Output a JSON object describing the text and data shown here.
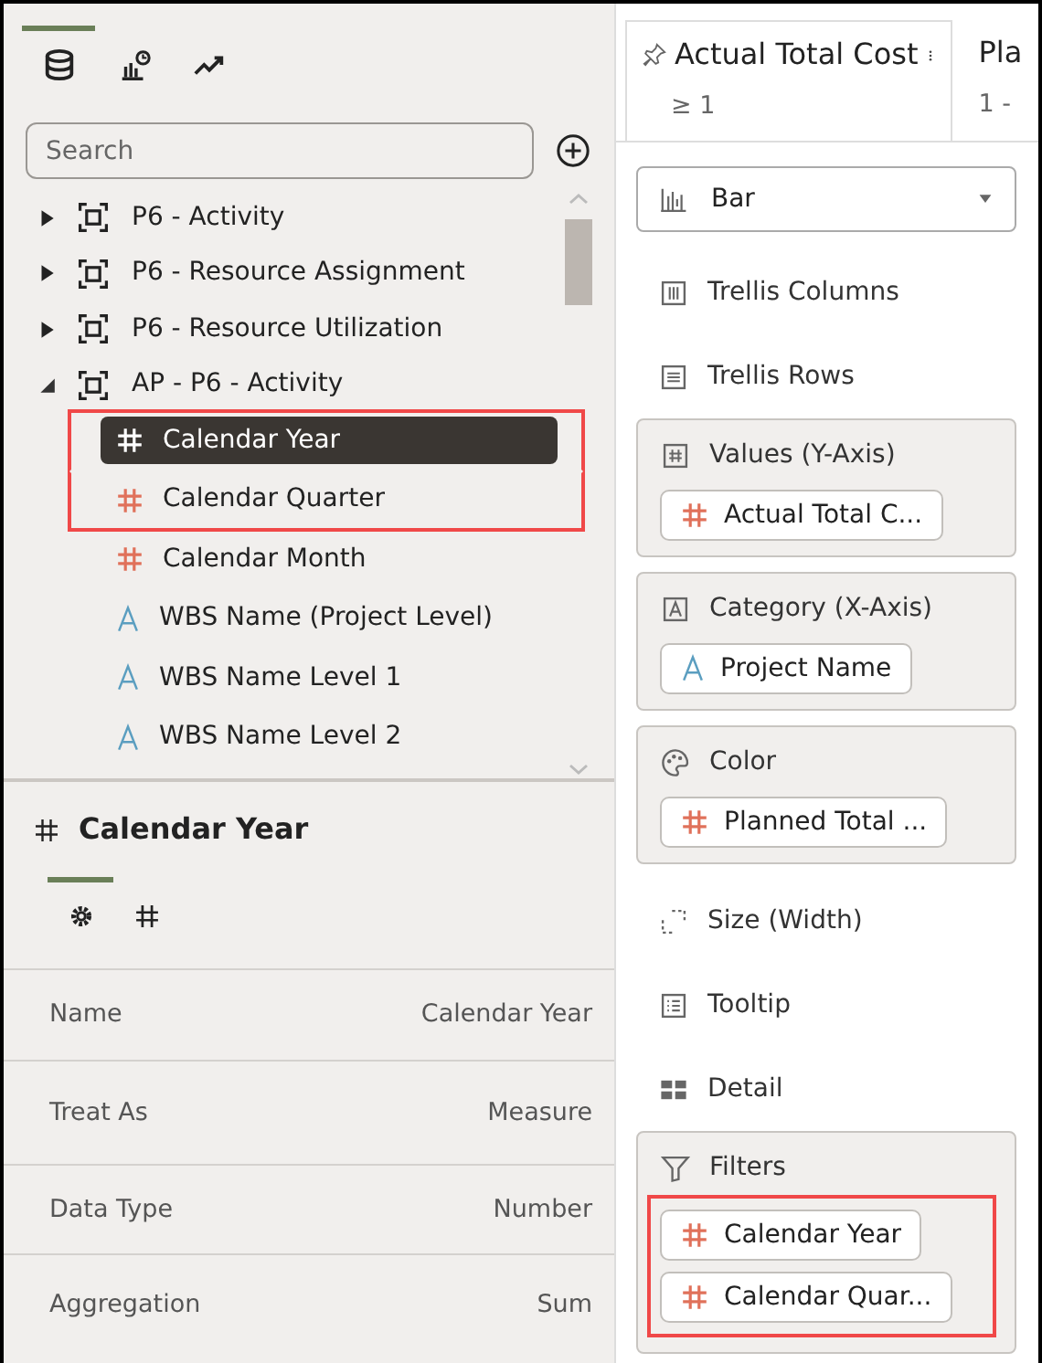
{
  "side_tabs": [
    {
      "kind": "database",
      "selected": true
    },
    {
      "kind": "chart",
      "selected": false
    },
    {
      "kind": "trend",
      "selected": false
    }
  ],
  "search": {
    "placeholder": "Search"
  },
  "tree": [
    {
      "label": "P6 - Activity",
      "expanded": false
    },
    {
      "label": "P6 - Resource Assignment",
      "expanded": false
    },
    {
      "label": "P6 - Resource Utilization",
      "expanded": false
    },
    {
      "label": "AP - P6 - Activity",
      "expanded": true,
      "children": [
        {
          "label": "Calendar Year",
          "kind": "measure",
          "selected": true,
          "highlighted": true
        },
        {
          "label": "Calendar Quarter",
          "kind": "measure",
          "selected": false,
          "highlighted": true
        },
        {
          "label": "Calendar Month",
          "kind": "measure",
          "selected": false,
          "highlighted": false
        },
        {
          "label": "WBS Name (Project Level)",
          "kind": "attribute",
          "selected": false,
          "highlighted": false
        },
        {
          "label": "WBS Name Level 1",
          "kind": "attribute",
          "selected": false,
          "highlighted": false
        },
        {
          "label": "WBS Name Level 2",
          "kind": "attribute",
          "selected": false,
          "highlighted": false
        }
      ]
    }
  ],
  "details": {
    "title": "Calendar Year",
    "kind": "measure",
    "tabs": [
      {
        "kind": "general",
        "selected": true
      },
      {
        "kind": "number",
        "selected": false
      }
    ],
    "properties": [
      {
        "label": "Name",
        "value": "Calendar Year"
      },
      {
        "label": "Treat As",
        "value": "Measure"
      },
      {
        "label": "Data Type",
        "value": "Number"
      },
      {
        "label": "Aggregation",
        "value": "Sum"
      }
    ]
  },
  "filter_cards": [
    {
      "title": "Actual Total Cost",
      "value": "≥ 1",
      "pinned": true
    },
    {
      "title": "Pla",
      "value": "1 -",
      "pinned": false
    }
  ],
  "chart_type": {
    "label": "Bar"
  },
  "grammar": [
    {
      "kind": "trellis_columns",
      "label": "Trellis Columns"
    },
    {
      "kind": "trellis_rows",
      "label": "Trellis Rows"
    },
    {
      "kind": "values",
      "label": "Values (Y-Axis)",
      "fields": [
        {
          "label": "Actual Total C...",
          "kind": "measure"
        }
      ]
    },
    {
      "kind": "category",
      "label": "Category (X-Axis)",
      "fields": [
        {
          "label": "Project Name",
          "kind": "attribute"
        }
      ]
    },
    {
      "kind": "color",
      "label": "Color",
      "fields": [
        {
          "label": "Planned Total ...",
          "kind": "measure"
        }
      ]
    },
    {
      "kind": "size",
      "label": "Size (Width)"
    },
    {
      "kind": "tooltip",
      "label": "Tooltip"
    },
    {
      "kind": "detail",
      "label": "Detail"
    },
    {
      "kind": "filters",
      "label": "Filters",
      "highlighted": true,
      "fields": [
        {
          "label": "Calendar Year",
          "kind": "measure"
        },
        {
          "label": "Calendar Quar...",
          "kind": "measure"
        }
      ]
    }
  ]
}
